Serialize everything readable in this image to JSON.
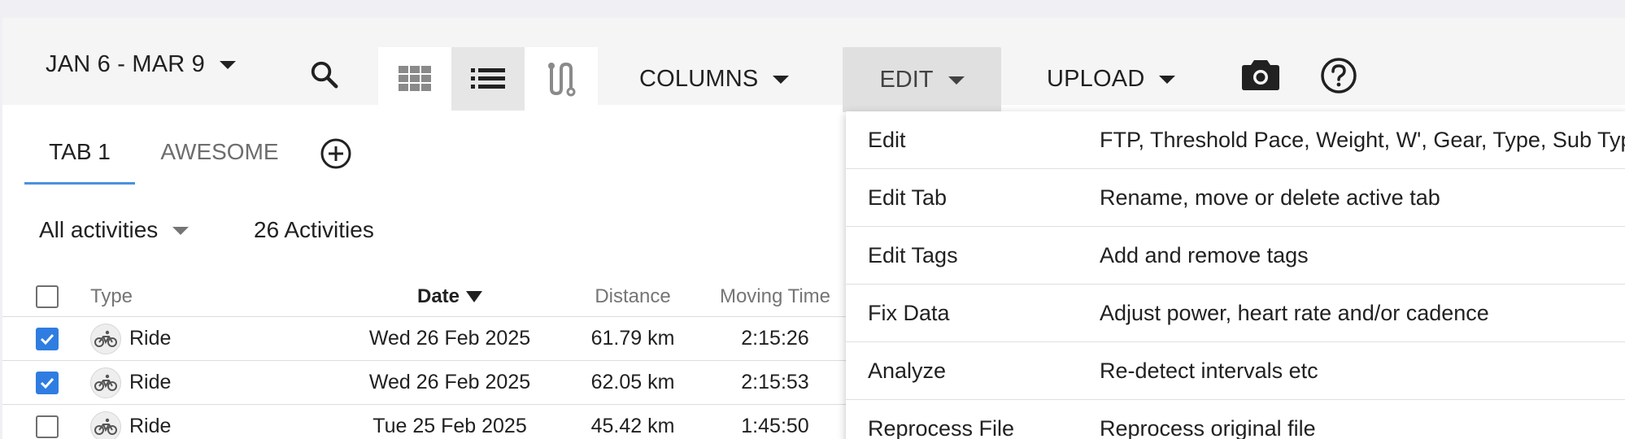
{
  "toolbar": {
    "date_range": "JAN 6 - MAR 9",
    "columns_label": "COLUMNS",
    "edit_label": "EDIT",
    "upload_label": "UPLOAD"
  },
  "tabs": [
    {
      "label": "TAB 1",
      "active": true
    },
    {
      "label": "AWESOME",
      "active": false
    }
  ],
  "filter": {
    "selected": "All activities",
    "count_text": "26 Activities"
  },
  "table": {
    "headers": {
      "type": "Type",
      "date": "Date",
      "distance": "Distance",
      "moving_time": "Moving Time"
    },
    "rows": [
      {
        "checked": true,
        "type": "Ride",
        "date": "Wed 26 Feb 2025",
        "distance": "61.79 km",
        "moving_time": "2:15:26"
      },
      {
        "checked": true,
        "type": "Ride",
        "date": "Wed 26 Feb 2025",
        "distance": "62.05 km",
        "moving_time": "2:15:53"
      },
      {
        "checked": false,
        "type": "Ride",
        "date": "Tue 25 Feb 2025",
        "distance": "45.42 km",
        "moving_time": "1:45:50"
      }
    ]
  },
  "edit_menu": [
    {
      "label": "Edit",
      "description": "FTP, Threshold Pace, Weight, W', Gear, Type, Sub Type"
    },
    {
      "label": "Edit Tab",
      "description": "Rename, move or delete active tab"
    },
    {
      "label": "Edit Tags",
      "description": "Add and remove tags"
    },
    {
      "label": "Fix Data",
      "description": "Adjust power, heart rate and/or cadence"
    },
    {
      "label": "Analyze",
      "description": "Re-detect intervals etc"
    },
    {
      "label": "Reprocess File",
      "description": "Reprocess original file"
    }
  ],
  "colors": {
    "accent": "#2f7de1",
    "tab_underline": "#4a90e2"
  },
  "icons": {
    "search": "search-icon",
    "grid_view": "grid-view-icon",
    "list_view": "list-view-icon",
    "route_view": "route-view-icon",
    "camera": "camera-icon",
    "help": "help-icon",
    "add_tab": "add-circle-icon",
    "ride": "bike-icon"
  }
}
